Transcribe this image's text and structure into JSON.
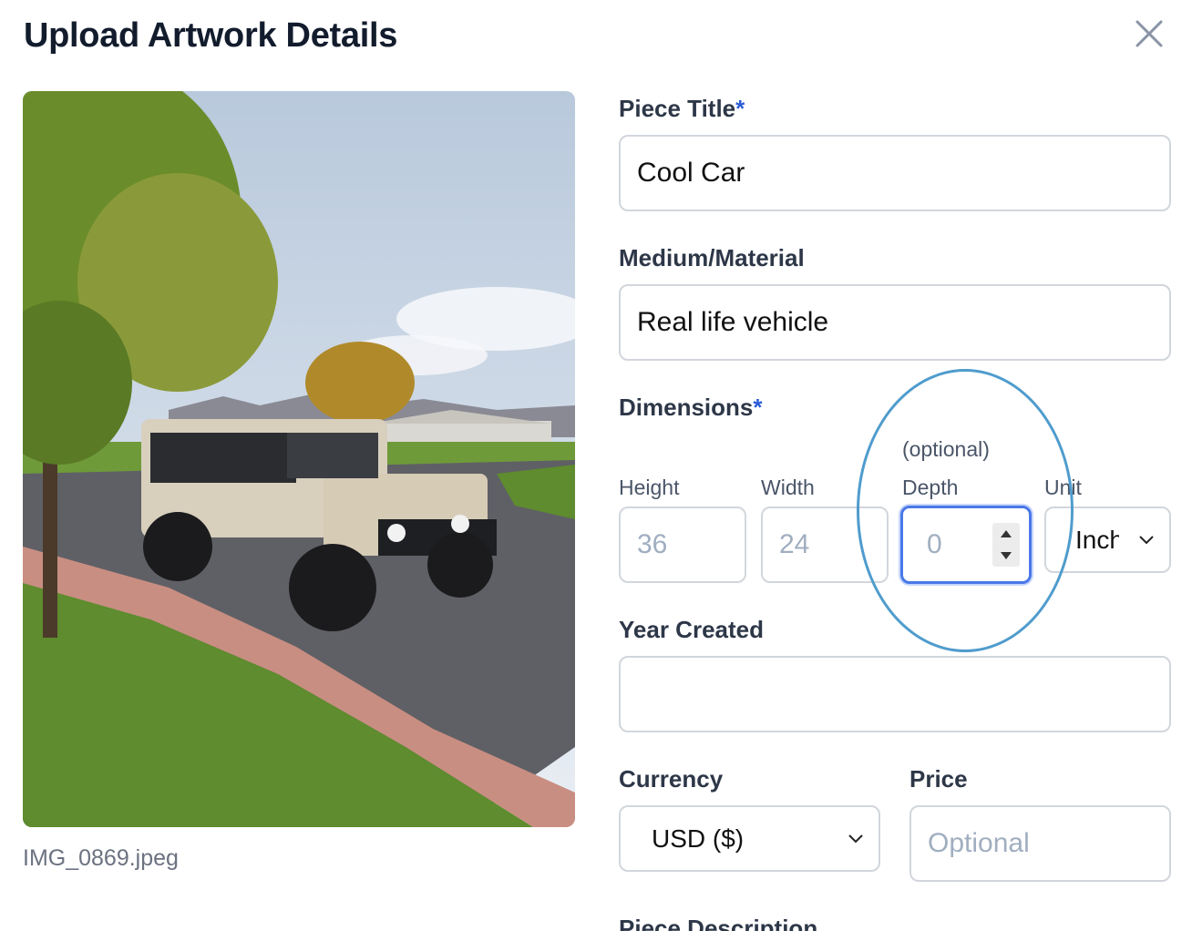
{
  "modal": {
    "title": "Upload Artwork Details",
    "close_icon": "close-icon"
  },
  "preview": {
    "filename": "IMG_0869.jpeg"
  },
  "form": {
    "title": {
      "label": "Piece Title",
      "required_mark": "*",
      "value": "Cool Car"
    },
    "medium": {
      "label": "Medium/Material",
      "value": "Real life vehicle"
    },
    "dimensions": {
      "label": "Dimensions",
      "required_mark": "*",
      "height": {
        "label": "Height",
        "placeholder": "36"
      },
      "width": {
        "label": "Width",
        "placeholder": "24"
      },
      "depth": {
        "optional_note": "(optional)",
        "label": "Depth",
        "placeholder": "0"
      },
      "unit": {
        "label": "Unit",
        "selected": "Inches"
      }
    },
    "year": {
      "label": "Year Created",
      "value": ""
    },
    "currency": {
      "label": "Currency",
      "selected": "USD ($)"
    },
    "price": {
      "label": "Price",
      "placeholder": "Optional"
    },
    "description": {
      "label": "Piece Description"
    }
  },
  "colors": {
    "accent": "#2b5bd7",
    "focus": "#4a78e8",
    "annotation": "#4f9ccd"
  }
}
